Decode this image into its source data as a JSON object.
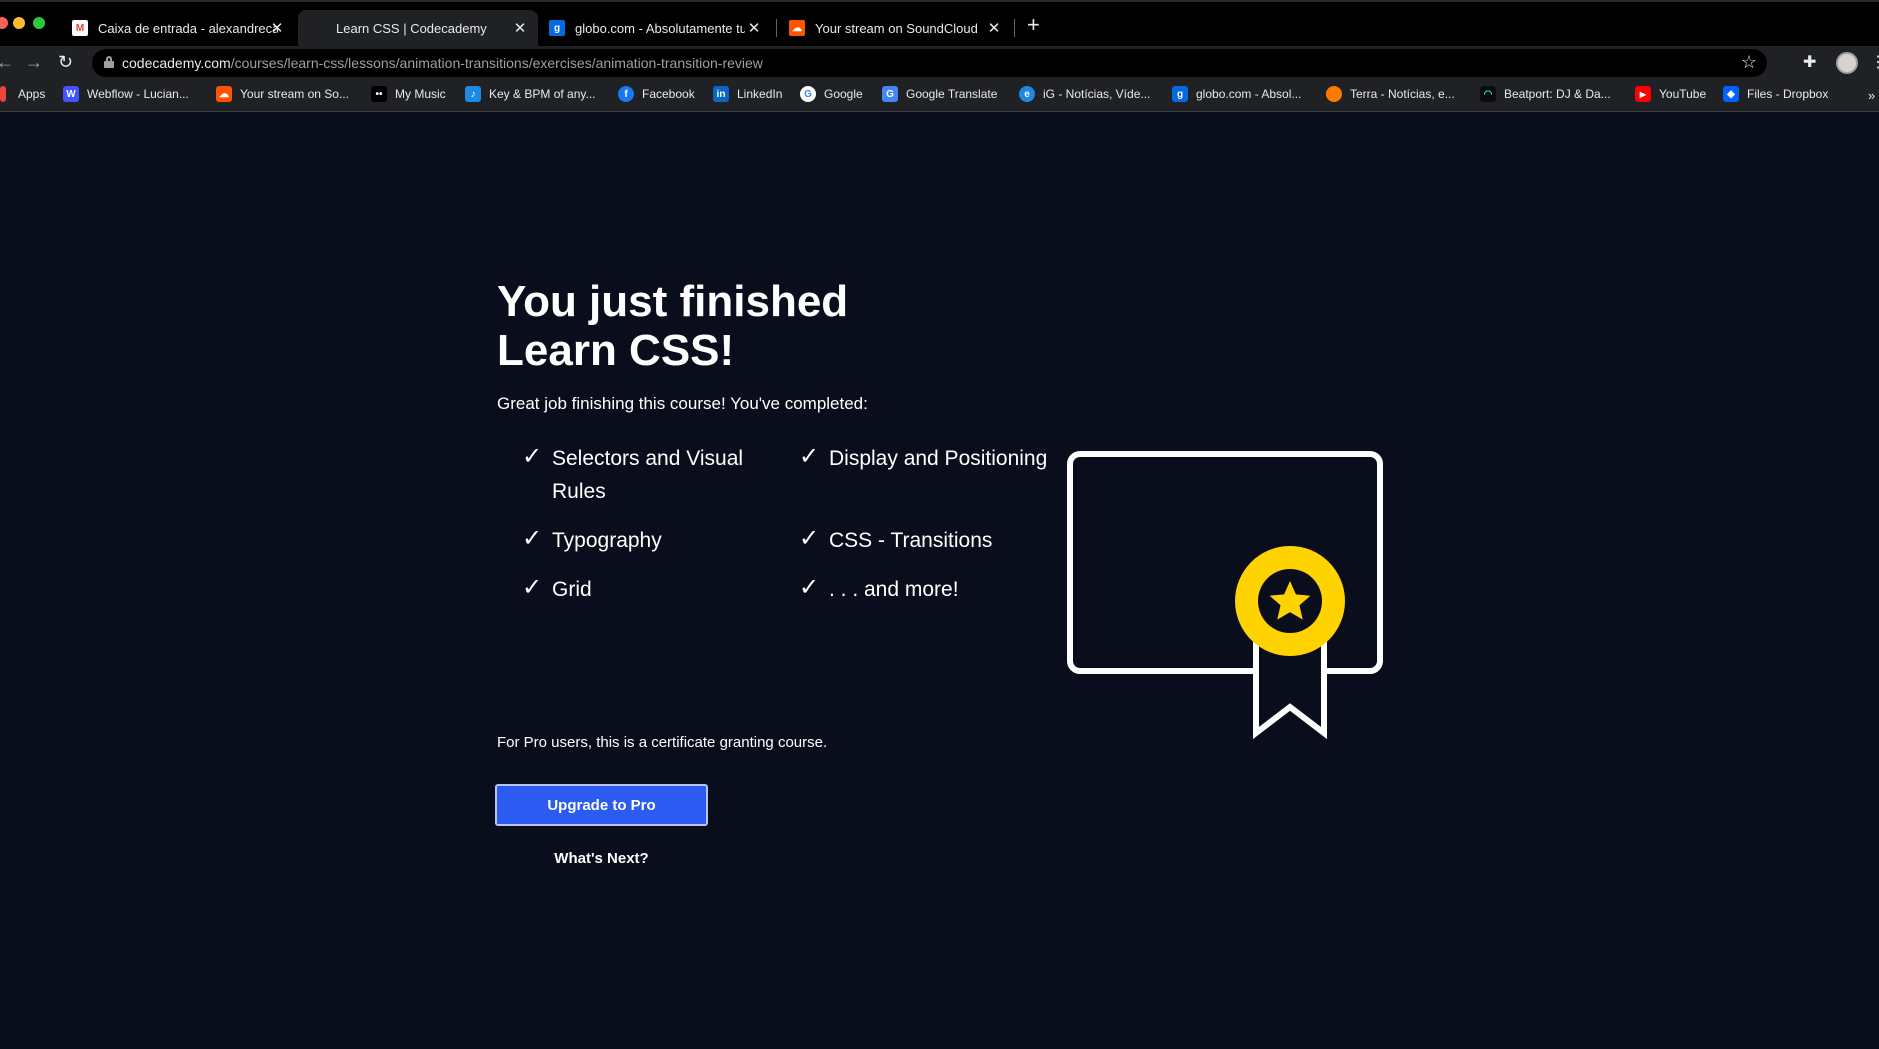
{
  "browser": {
    "tabs": [
      {
        "title": "Caixa de entrada - alexandreca",
        "favicon": "gmail-icon",
        "active": false
      },
      {
        "title": "Learn CSS | Codecademy",
        "favicon": "codecademy-icon",
        "active": true
      },
      {
        "title": "globo.com - Absolutamente tu",
        "favicon": "globo-icon",
        "active": false
      },
      {
        "title": "Your stream on SoundCloud",
        "favicon": "soundcloud-icon",
        "active": false
      }
    ],
    "url_host": "codecademy.com",
    "url_path": "/courses/learn-css/lessons/animation-transitions/exercises/animation-transition-review",
    "bookmarks": [
      {
        "label": "Apps",
        "icon": "apps-grid-icon",
        "color": "#e8453c"
      },
      {
        "label": "Webflow - Lucian...",
        "icon": "webflow-icon",
        "color": "#4353ff"
      },
      {
        "label": "Your stream on So...",
        "icon": "soundcloud-icon",
        "color": "#ff5500"
      },
      {
        "label": "My Music",
        "icon": "music-icon",
        "color": "#000000"
      },
      {
        "label": "Key & BPM of any...",
        "icon": "drop-icon",
        "color": "#1e88e5"
      },
      {
        "label": "Facebook",
        "icon": "facebook-icon",
        "color": "#1877f2"
      },
      {
        "label": "LinkedIn",
        "icon": "linkedin-icon",
        "color": "#0a66c2"
      },
      {
        "label": "Google",
        "icon": "google-icon",
        "color": "#ffffff"
      },
      {
        "label": "Google Translate",
        "icon": "translate-icon",
        "color": "#4285f4"
      },
      {
        "label": "iG - Notícias, Víde...",
        "icon": "ig-icon",
        "color": "#1e88e5"
      },
      {
        "label": "globo.com - Absol...",
        "icon": "globo-icon",
        "color": "#0669de"
      },
      {
        "label": "Terra - Notícias, e...",
        "icon": "terra-icon",
        "color": "#ff7a00"
      },
      {
        "label": "Beatport: DJ & Da...",
        "icon": "beatport-icon",
        "color": "#01ff95"
      },
      {
        "label": "YouTube",
        "icon": "youtube-icon",
        "color": "#ff0000"
      },
      {
        "label": "Files - Dropbox",
        "icon": "dropbox-icon",
        "color": "#0061ff"
      }
    ],
    "more_bookmarks": "»"
  },
  "content": {
    "heading_line1": "You just finished",
    "heading_line2": "Learn CSS!",
    "subtext": "Great job finishing this course! You've completed:",
    "completed_items": [
      "Selectors and Visual Rules",
      "Display and Positioning",
      "Typography",
      "CSS - Transitions",
      "Grid",
      ". . . and more!"
    ],
    "certificate_icon": "certificate-ribbon-icon",
    "pro_note": "For Pro users, this is a certificate granting course.",
    "upgrade_button": "Upgrade to Pro",
    "whats_next": "What's Next?"
  },
  "colors": {
    "page_background": "#0a0d1c",
    "button_blue": "#2b5bf0",
    "medal_yellow": "#ffd300"
  }
}
